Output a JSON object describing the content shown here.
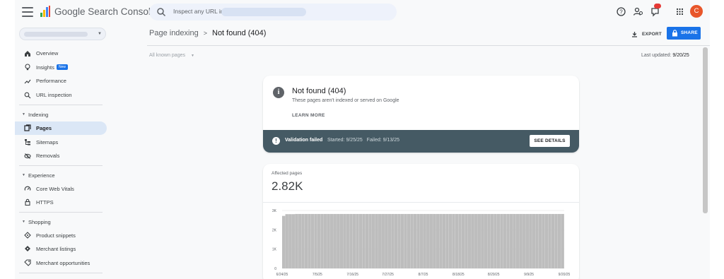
{
  "app": {
    "title": "Google Search Console"
  },
  "search": {
    "placeholder": "Inspect any URL in"
  },
  "notifications": {
    "count": ""
  },
  "user": {
    "initial": "C"
  },
  "sidebar": {
    "items": [
      {
        "label": "Overview"
      },
      {
        "label": "Insights",
        "badge": "New"
      },
      {
        "label": "Performance"
      },
      {
        "label": "URL inspection"
      }
    ],
    "sections": [
      {
        "label": "Indexing",
        "items": [
          {
            "label": "Pages"
          },
          {
            "label": "Sitemaps"
          },
          {
            "label": "Removals"
          }
        ]
      },
      {
        "label": "Experience",
        "items": [
          {
            "label": "Core Web Vitals"
          },
          {
            "label": "HTTPS"
          }
        ]
      },
      {
        "label": "Shopping",
        "items": [
          {
            "label": "Product snippets"
          },
          {
            "label": "Merchant listings"
          },
          {
            "label": "Merchant opportunities"
          }
        ]
      }
    ]
  },
  "header": {
    "breadcrumb_parent": "Page indexing",
    "breadcrumb_current": "Not found (404)",
    "export_label": "EXPORT",
    "share_label": "SHARE",
    "filter_label": "All known pages",
    "last_updated_label": "Last updated:",
    "last_updated_value": "9/20/25"
  },
  "issue": {
    "title": "Not found (404)",
    "description": "These pages aren't indexed or served on Google",
    "learn_more": "LEARN MORE",
    "validation_status": "Validation failed",
    "started": "Started: 9/25/25",
    "failed": "Failed: 9/13/25",
    "see_details": "SEE DETAILS"
  },
  "affected": {
    "label": "Affected pages",
    "value": "2.82K"
  },
  "colors": {
    "accent": "#1a73e8",
    "validation_bar": "#455a64",
    "chart_fill": "#bdbdbd",
    "avatar": "#e8562a",
    "active_nav": "#dbe7f6"
  },
  "chart_data": {
    "type": "bar",
    "title": "",
    "xlabel": "",
    "ylabel": "",
    "ylim": [
      0,
      3000
    ],
    "yticks": [
      "3K",
      "2K",
      "1K",
      "0"
    ],
    "xticks": [
      "6/24/25",
      "7/5/25",
      "7/16/25",
      "7/27/25",
      "8/7/25",
      "8/18/25",
      "8/29/25",
      "9/9/25",
      "9/20/25"
    ],
    "series": [
      {
        "values": [
          2720,
          2810,
          2810,
          2810,
          2820,
          2820,
          2820,
          2820,
          2820,
          2820,
          2820,
          2820,
          2820,
          2820,
          2820,
          2820,
          2820,
          2820,
          2820,
          2820,
          2820,
          2820,
          2820,
          2820,
          2820,
          2820,
          2820,
          2820,
          2820,
          2820,
          2820,
          2820,
          2820,
          2820,
          2820,
          2820,
          2820,
          2820,
          2820,
          2820,
          2820,
          2820,
          2820,
          2820,
          2820,
          2820,
          2820,
          2820,
          2820,
          2820,
          2820,
          2820,
          2820,
          2820,
          2820,
          2820,
          2820,
          2820,
          2820,
          2820,
          2820,
          2820,
          2820,
          2820,
          2820,
          2820,
          2820,
          2820,
          2820,
          2820,
          2820,
          2820,
          2820,
          2820,
          2820,
          2820,
          2820,
          2820,
          2820,
          2820,
          2820,
          2820,
          2820,
          2820,
          2820,
          2820,
          2820,
          2820
        ]
      }
    ]
  }
}
